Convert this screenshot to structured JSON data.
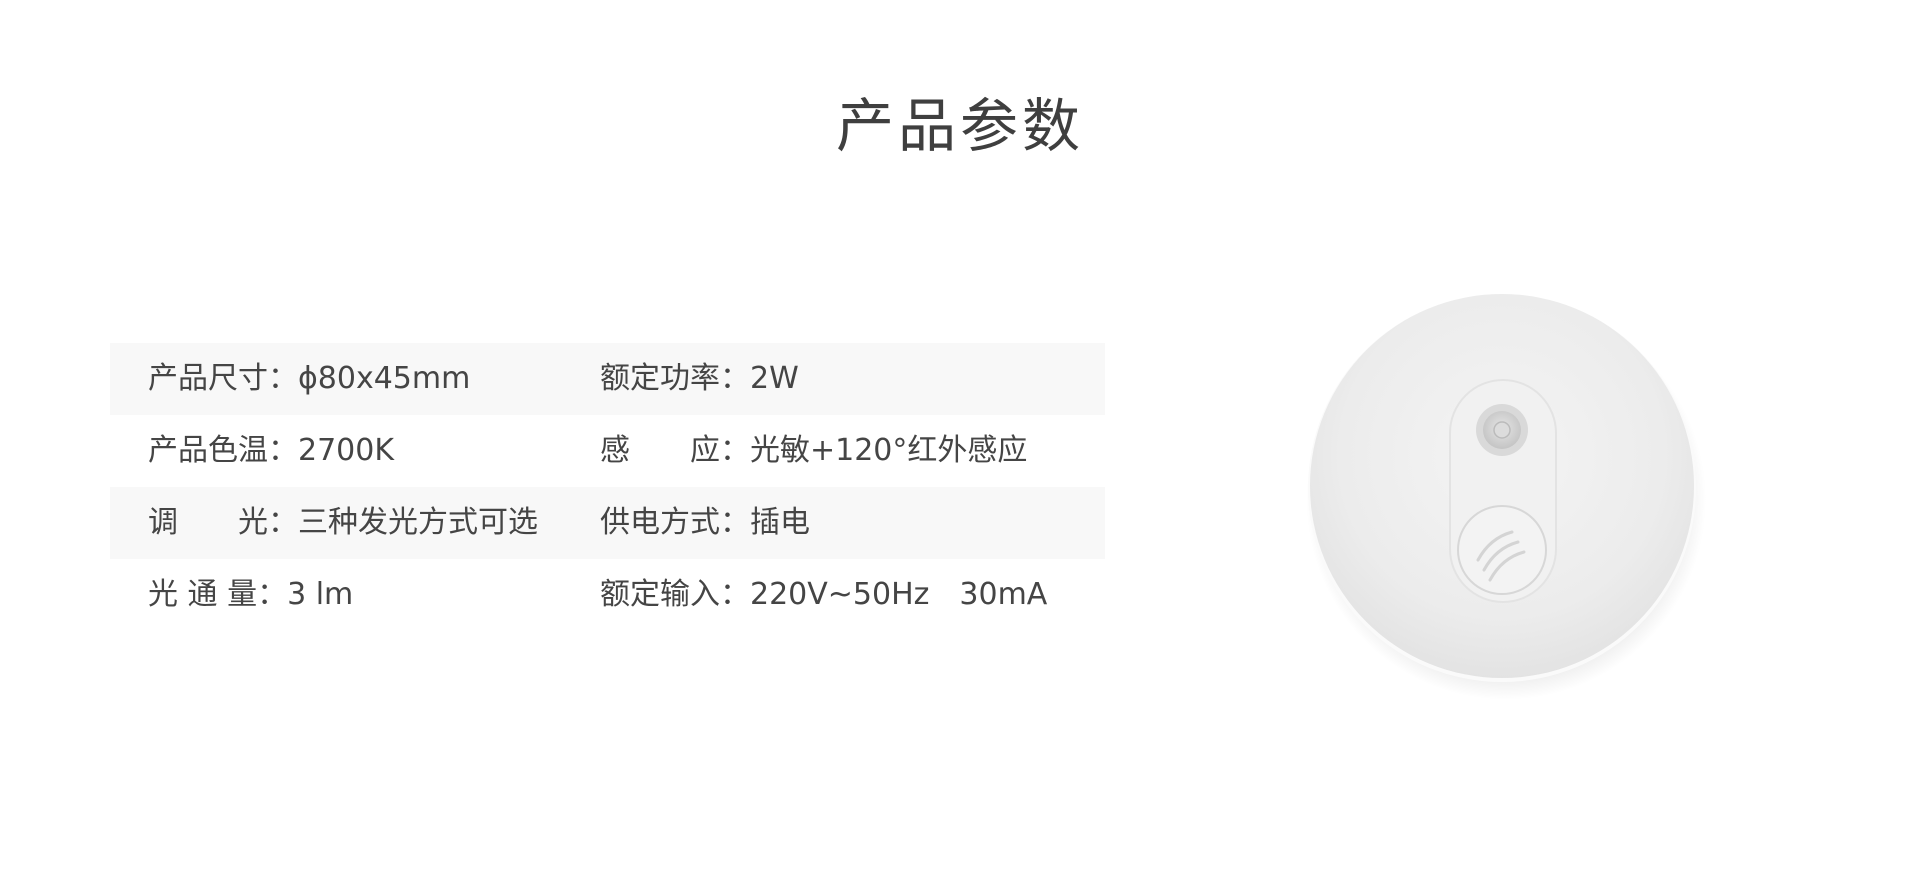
{
  "title": "产品参数",
  "specs": [
    {
      "left": {
        "label": "产品尺寸：",
        "value": "ϕ80x45mm"
      },
      "right": {
        "label": "额定功率：",
        "value": "2W"
      }
    },
    {
      "left": {
        "label": "产品色温：",
        "value": "2700K"
      },
      "right": {
        "label": "感　　应：",
        "value": "光敏+120°红外感应"
      }
    },
    {
      "left": {
        "label": "调　　光：",
        "value": "三种发光方式可选"
      },
      "right": {
        "label": "供电方式：",
        "value": "插电"
      }
    },
    {
      "left": {
        "label": "光 通 量：",
        "value": "3 lm"
      },
      "right": {
        "label": "额定输入：",
        "value": "220V~50Hz　30mA"
      }
    }
  ],
  "product_image": {
    "icon": "round-night-light-with-pir-sensor"
  },
  "colors": {
    "text": "#454545",
    "row_shade": "#f8f8f8",
    "title": "#3f3f3f"
  }
}
